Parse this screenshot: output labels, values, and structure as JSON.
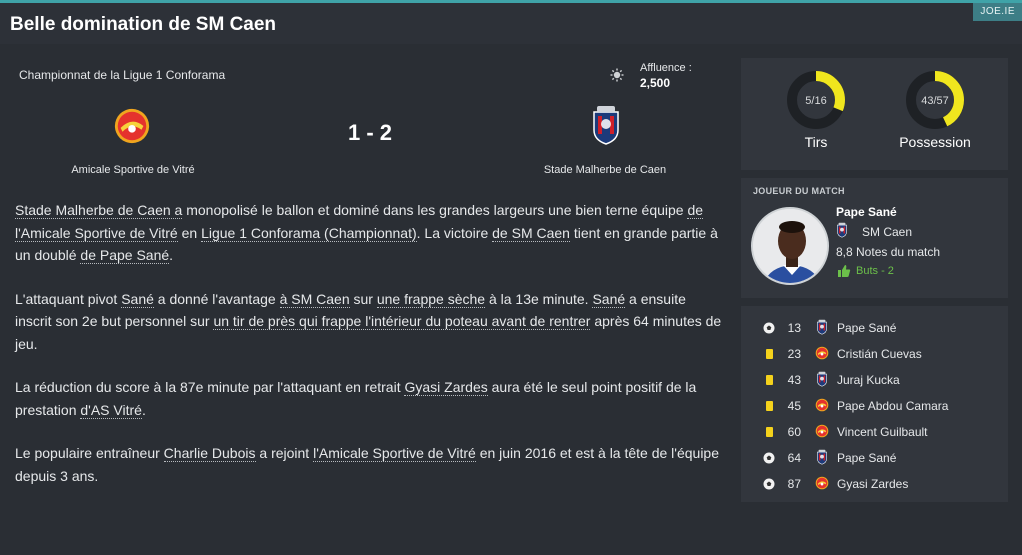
{
  "header": {
    "title": "Belle domination de SM Caen",
    "brand": "JOE.IE"
  },
  "match": {
    "competition": "Championnat de la Ligue 1 Conforama",
    "attendance_label": "Affluence :",
    "attendance_value": "2,500",
    "score": "1 - 2",
    "home_team": "Amicale Sportive de Vitré",
    "away_team": "Stade Malherbe de Caen"
  },
  "report": {
    "p1": {
      "a": "Stade Malherbe de Caen a",
      "b": " monopolisé le ballon et dominé dans les grandes largeurs une bien terne équipe ",
      "c": "de l'Amicale Sportive de Vitré",
      "d": " en ",
      "e": "Ligue 1 Conforama (Championnat)",
      "f": ". La victoire ",
      "g": "de SM Caen",
      "h": " tient en grande partie à un doublé ",
      "i": "de Pape Sané",
      "j": "."
    },
    "p2": {
      "a": "L'attaquant pivot ",
      "b": "Sané",
      "c": " a donné l'avantage ",
      "d": "à SM Caen",
      "e": " sur ",
      "f": "une frappe sèche",
      "g": " à la 13e minute. ",
      "h": "Sané",
      "i": " a ensuite inscrit son 2e but personnel sur ",
      "j": "un tir de près qui frappe l'intérieur du poteau avant de rentrer",
      "k": " après 64 minutes de jeu."
    },
    "p3": {
      "a": "La réduction du score à la 87e minute par l'attaquant en retrait ",
      "b": "Gyasi Zardes",
      "c": " aura été le seul point positif de la prestation ",
      "d": "d'AS Vitré",
      "e": "."
    },
    "p4": {
      "a": "Le populaire entraîneur ",
      "b": "Charlie Dubois",
      "c": " a rejoint ",
      "d": "l'Amicale Sportive de Vitré",
      "e": " en juin 2016 et est à la tête de l'équipe depuis 3 ans."
    }
  },
  "stats": {
    "shots": {
      "text": "5/16",
      "label": "Tirs",
      "fraction": 0.3125
    },
    "possession": {
      "text": "43/57",
      "label": "Possession",
      "fraction": 0.43
    },
    "accent_color": "#f0e61e",
    "track_color": "#1e2125"
  },
  "motm": {
    "header": "JOUEUR DU MATCH",
    "name": "Pape Sané",
    "club": "SM Caen",
    "rating": "8,8 Notes du match",
    "goals": "Buts - 2",
    "goals_color": "#6cc04a"
  },
  "events": [
    {
      "type": "goal",
      "minute": "13",
      "team": "caen",
      "player": "Pape Sané"
    },
    {
      "type": "yellow-card",
      "minute": "23",
      "team": "vitre",
      "player": "Cristián Cuevas"
    },
    {
      "type": "yellow-card",
      "minute": "43",
      "team": "caen",
      "player": "Juraj Kucka"
    },
    {
      "type": "yellow-card",
      "minute": "45",
      "team": "vitre",
      "player": "Pape Abdou Camara"
    },
    {
      "type": "yellow-card",
      "minute": "60",
      "team": "vitre",
      "player": "Vincent Guilbault"
    },
    {
      "type": "goal",
      "minute": "64",
      "team": "caen",
      "player": "Pape Sané"
    },
    {
      "type": "goal",
      "minute": "87",
      "team": "vitre",
      "player": "Gyasi Zardes"
    }
  ]
}
